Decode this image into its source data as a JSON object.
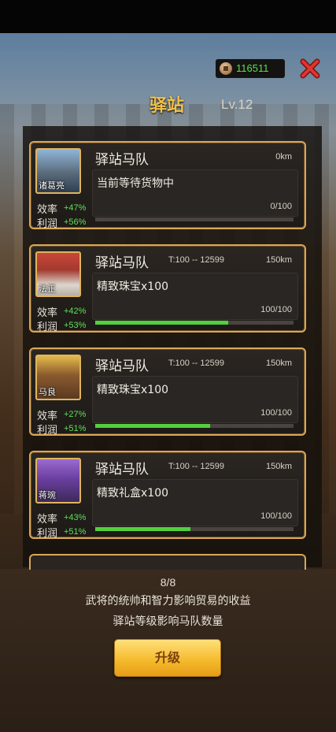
{
  "header": {
    "coins": "116511",
    "title": "驿站",
    "level": "Lv.12"
  },
  "caravans": [
    {
      "general": "诸葛亮",
      "efficiency_label": "效率",
      "efficiency": "+47%",
      "profit_label": "利润",
      "profit": "+56%",
      "name": "驿站马队",
      "trip": "",
      "distance": "0km",
      "cargo": "当前等待货物中",
      "progress_text": "0/100",
      "progress": 0
    },
    {
      "general": "法正",
      "efficiency_label": "效率",
      "efficiency": "+42%",
      "profit_label": "利润",
      "profit": "+53%",
      "name": "驿站马队",
      "trip": "T:100 -- 12599",
      "distance": "150km",
      "cargo": "精致珠宝x100",
      "progress_text": "100/100",
      "progress": 0.67
    },
    {
      "general": "马良",
      "efficiency_label": "效率",
      "efficiency": "+27%",
      "profit_label": "利润",
      "profit": "+51%",
      "name": "驿站马队",
      "trip": "T:100 -- 12599",
      "distance": "150km",
      "cargo": "精致珠宝x100",
      "progress_text": "100/100",
      "progress": 0.58
    },
    {
      "general": "蒋琬",
      "efficiency_label": "效率",
      "efficiency": "+43%",
      "profit_label": "利润",
      "profit": "+51%",
      "name": "驿站马队",
      "trip": "T:100 -- 12599",
      "distance": "150km",
      "cargo": "精致礼盒x100",
      "progress_text": "100/100",
      "progress": 0.48
    }
  ],
  "footer": {
    "count": "8/8",
    "info1": "武将的统帅和智力影响贸易的收益",
    "info2": "驿站等级影响马队数量",
    "upgrade_label": "升级"
  },
  "colors": {
    "title": "#f2c14a",
    "bonus": "#5fe05a",
    "progress": "#52d03c",
    "card_border": "#d8a75a",
    "button": "#f4b82a"
  },
  "icons": {
    "coin": "coin-icon",
    "close": "close-icon"
  }
}
